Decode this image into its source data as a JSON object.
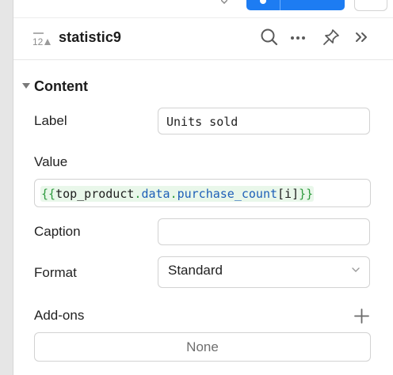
{
  "inspector": {
    "component_name": "statistic9",
    "component_type_icon": "number-12-icon",
    "header_icons": [
      "search-icon",
      "more-horizontal-icon",
      "pin-icon",
      "collapse-panel-icon"
    ]
  },
  "content_section": {
    "title": "Content",
    "label_field": {
      "label": "Label",
      "value": "Units sold"
    },
    "value_field": {
      "label": "Value",
      "expression_tokens": [
        {
          "t": "{{",
          "k": "brace"
        },
        {
          "t": "top_product",
          "k": "ident"
        },
        {
          "t": ".",
          "k": "dot"
        },
        {
          "t": "data",
          "k": "prop"
        },
        {
          "t": ".",
          "k": "dot"
        },
        {
          "t": "purchase_count",
          "k": "prop"
        },
        {
          "t": "[i]",
          "k": "ident"
        },
        {
          "t": "}}",
          "k": "brace"
        }
      ]
    },
    "caption_field": {
      "label": "Caption",
      "value": ""
    },
    "format_field": {
      "label": "Format",
      "selected": "Standard"
    },
    "addons": {
      "label": "Add-ons",
      "empty_text": "None"
    }
  },
  "colors": {
    "accent": "#1d7cf2",
    "code_brace": "#2e9a3e",
    "code_prop": "#1d5fb8",
    "code_bg": "#e9f7ea"
  }
}
